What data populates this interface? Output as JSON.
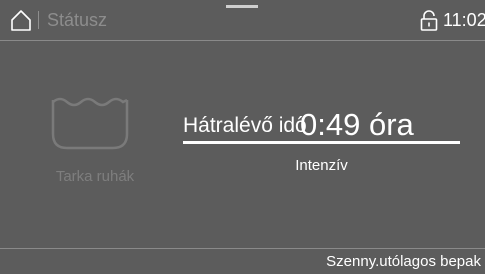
{
  "header": {
    "title": "Státusz",
    "time": "11:02",
    "home_icon": "home-icon",
    "lock_icon": "lock-open-icon"
  },
  "program": {
    "name": "Tarka ruhák",
    "icon": "wash-tub-icon"
  },
  "status": {
    "remaining_label": "Hátralévő idő",
    "remaining_value": "0:49 óra",
    "progress": 1.0,
    "option": "Intenzív"
  },
  "footer": {
    "text": "Szenny.utólagos bepak"
  },
  "colors": {
    "background": "#5c5c5c",
    "text": "#ffffff",
    "muted": "#8d8d8d"
  }
}
